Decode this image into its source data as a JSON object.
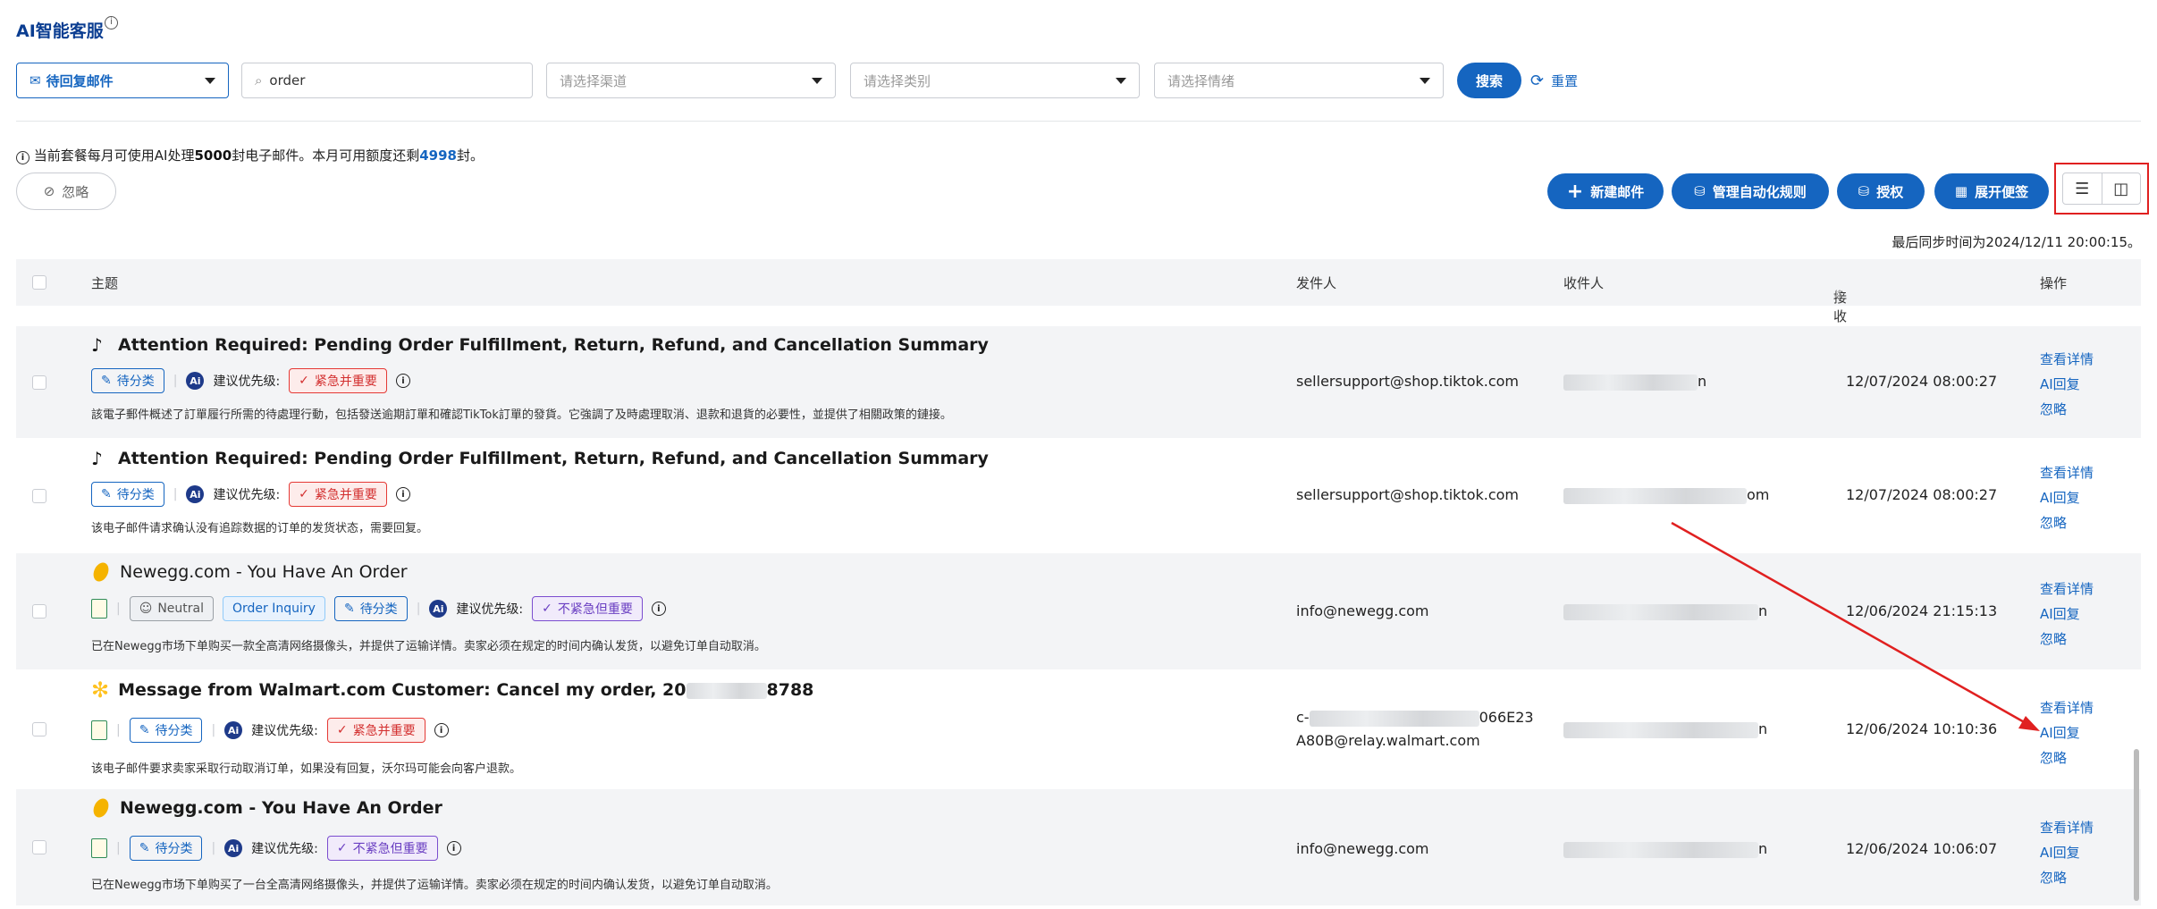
{
  "app": {
    "title": "AI智能客服"
  },
  "filters": {
    "mailbox": "待回复邮件",
    "search_value": "order",
    "channel_placeholder": "请选择渠道",
    "category_placeholder": "请选择类别",
    "sentiment_placeholder": "请选择情绪",
    "search_button": "搜索",
    "reset_button": "重置"
  },
  "quota": {
    "text_a": "当前套餐每月可使用AI处理",
    "limit": "5000",
    "text_b": "封电子邮件。本月可用额度还剩",
    "remaining": "4998",
    "text_c": "封。"
  },
  "toolbar": {
    "ignore": "忽略",
    "new_mail": "新建邮件",
    "manage_rules": "管理自动化规则",
    "authorize": "授权",
    "notes": "展开便签"
  },
  "sync_text": "最后同步时间为2024/12/11 20:00:15。",
  "table": {
    "headers": {
      "subject": "主题",
      "sender": "发件人",
      "recipient": "收件人",
      "date": "接收日期",
      "ops": "操作"
    },
    "ops_labels": {
      "view": "查看详情",
      "ai_reply": "AI回复",
      "ignore": "忽略"
    },
    "rows": [
      {
        "subject": "Attention Required: Pending Order Fulfillment, Return, Refund, and Cancellation Summary",
        "status": "待分类",
        "priority_label": "建议优先级:",
        "priority": "紧急并重要",
        "summary": "該電子郵件概述了訂單履行所需的待處理行動，包括發送逾期訂單和確認TikTok訂單的發貨。它強調了及時處理取消、退款和退貨的必要性，並提供了相關政策的鏈接。",
        "sender": "sellersupport@shop.tiktok.com",
        "recipient_tail": "n",
        "date": "12/07/2024 08:00:27"
      },
      {
        "subject": "Attention Required: Pending Order Fulfillment, Return, Refund, and Cancellation Summary",
        "status": "待分类",
        "priority_label": "建议优先级:",
        "priority": "紧急并重要",
        "summary": "该电子邮件请求确认没有追踪数据的订单的发货状态，需要回复。",
        "sender": "sellersupport@shop.tiktok.com",
        "recipient_tail": "om",
        "date": "12/07/2024 08:00:27"
      },
      {
        "subject": "Newegg.com - You Have An Order",
        "sentiment": "Neutral",
        "category": "Order Inquiry",
        "status": "待分类",
        "priority_label": "建议优先级:",
        "priority": "不紧急但重要",
        "summary": "已在Newegg市场下单购买一款全高清网络摄像头，并提供了运输详情。卖家必须在规定的时间内确认发货，以避免订单自动取消。",
        "sender": "info@newegg.com",
        "recipient_tail": "n",
        "date": "12/06/2024 21:15:13"
      },
      {
        "subject_a": "Message from Walmart.com Customer: Cancel my order, 20",
        "subject_b": "8788",
        "status": "待分类",
        "priority_label": "建议优先级:",
        "priority": "紧急并重要",
        "summary": "该电子邮件要求卖家采取行动取消订单，如果没有回复，沃尔玛可能会向客户退款。",
        "sender_a": "c-",
        "sender_a_tail": "066E23",
        "sender_b": "A80B@relay.walmart.com",
        "recipient_tail": "n",
        "date": "12/06/2024 10:10:36"
      },
      {
        "subject": "Newegg.com - You Have An Order",
        "status": "待分类",
        "priority_label": "建议优先级:",
        "priority": "不紧急但重要",
        "summary": "已在Newegg市场下单购买了一台全高清网络摄像头，并提供了运输详情。卖家必须在规定的时间内确认发货，以避免订单自动取消。",
        "sender": "info@newegg.com",
        "recipient_tail": "n",
        "date": "12/06/2024 10:06:07"
      }
    ]
  },
  "colors": {
    "primary": "#1565c0",
    "annotation_red": "#e02020"
  }
}
